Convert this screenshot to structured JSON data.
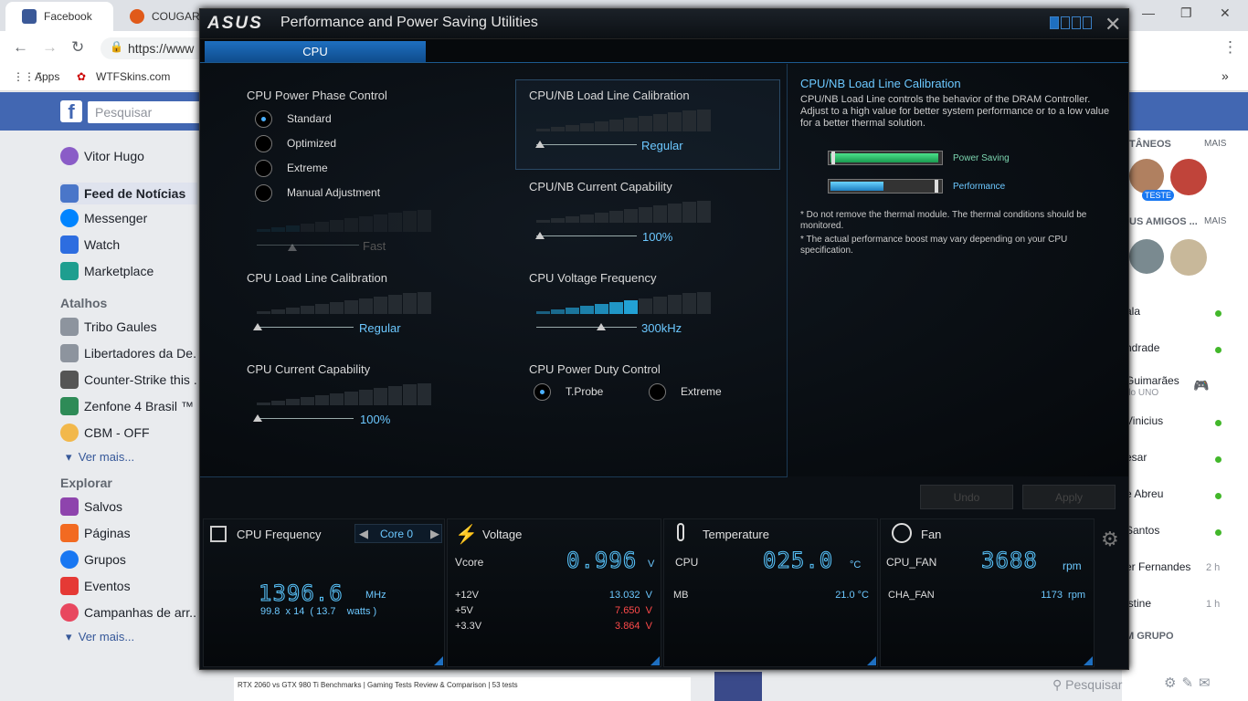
{
  "browser": {
    "tab1": "Facebook",
    "tab2": "COUGAR",
    "url": "https://www",
    "bookmarks": [
      "Apps",
      "WTFSkins.com"
    ]
  },
  "facebook": {
    "search_placeholder": "Pesquisar",
    "user": "Vitor Hugo",
    "nav": [
      "Feed de Notícias",
      "Messenger",
      "Watch",
      "Marketplace"
    ],
    "shortcuts_head": "Atalhos",
    "shortcuts": [
      "Tribo Gaules",
      "Libertadores da De...",
      "Counter-Strike this ...",
      "Zenfone 4 Brasil ™",
      "CBM - OFF"
    ],
    "see_more": "Ver mais...",
    "explore_head": "Explorar",
    "explore": [
      "Salvos",
      "Páginas",
      "Grupos",
      "Eventos",
      "Campanhas de arr..."
    ],
    "right": {
      "h1": "TÂNEOS",
      "more1": "MAIS",
      "h2": "US AMIGOS ...",
      "more2": "MAIS",
      "friends": [
        "ala",
        "ndrade",
        "Guimarães",
        "Vinicius",
        "esar",
        "e Abreu",
        "Santos",
        "er Fernandes",
        "istine"
      ],
      "uno": "do UNO",
      "time1": "2 h",
      "time2": "1 h",
      "group": "M GRUPO",
      "badge": "TESTE",
      "search": "Pesquisar"
    },
    "video_caption": "RTX 2060 vs GTX 980 Ti Benchmarks | Gaming Tests Review & Comparison | 53 tests"
  },
  "asus": {
    "logo": "ASUS",
    "title": "Performance and Power Saving Utilities",
    "tab": "CPU",
    "phase": {
      "title": "CPU Power Phase Control",
      "options": [
        "Standard",
        "Optimized",
        "Extreme",
        "Manual Adjustment"
      ],
      "selected": "Standard",
      "slider_value": "Fast"
    },
    "cpu_llc": {
      "title": "CPU Load Line Calibration",
      "value": "Regular"
    },
    "cpu_cc": {
      "title": "CPU Current Capability",
      "value": "100%"
    },
    "nb_llc": {
      "title": "CPU/NB Load Line Calibration",
      "value": "Regular"
    },
    "nb_cc": {
      "title": "CPU/NB Current Capability",
      "value": "100%"
    },
    "vfreq": {
      "title": "CPU Voltage Frequency",
      "value": "300kHz"
    },
    "duty": {
      "title": "CPU Power Duty Control",
      "options": [
        "T.Probe",
        "Extreme"
      ],
      "selected": "T.Probe"
    },
    "info": {
      "title": "CPU/NB Load Line Calibration",
      "desc": "CPU/NB Load Line controls the behavior of the DRAM Controller. Adjust to a high value for better system performance or to a low value for a better thermal solution.",
      "power_saving": "Power Saving",
      "performance": "Performance",
      "note1": "Do not remove the thermal module. The thermal conditions should be monitored.",
      "note2": "The actual performance boost may vary depending on your CPU specification."
    },
    "buttons": {
      "undo": "Undo",
      "apply": "Apply"
    },
    "monitor": {
      "freq": {
        "title": "CPU Frequency",
        "core": "Core 0",
        "value": "1396.6",
        "unit": "MHz",
        "detail": "99.8  x 14  ( 13.7    watts )"
      },
      "voltage": {
        "title": "Voltage",
        "vcore_label": "Vcore",
        "vcore": "0.996",
        "vunit": "V",
        "rails": [
          {
            "label": "+12V",
            "value": "13.032  V"
          },
          {
            "label": "+5V",
            "value": "7.650  V"
          },
          {
            "label": "+3.3V",
            "value": "3.864  V"
          }
        ]
      },
      "temp": {
        "title": "Temperature",
        "cpu_label": "CPU",
        "cpu": "025.0",
        "unit": "°C",
        "mb_label": "MB",
        "mb": "21.0 °C"
      },
      "fan": {
        "title": "Fan",
        "cpu_label": "CPU_FAN",
        "cpu": "3688",
        "unit": "rpm",
        "cha_label": "CHA_FAN",
        "cha": "1173  rpm"
      }
    }
  },
  "colors": {
    "accent": "#1e6fc0",
    "value_blue": "#6cc8ff",
    "alert_red": "#ff4a4a",
    "facebook_blue": "#4267b2"
  }
}
